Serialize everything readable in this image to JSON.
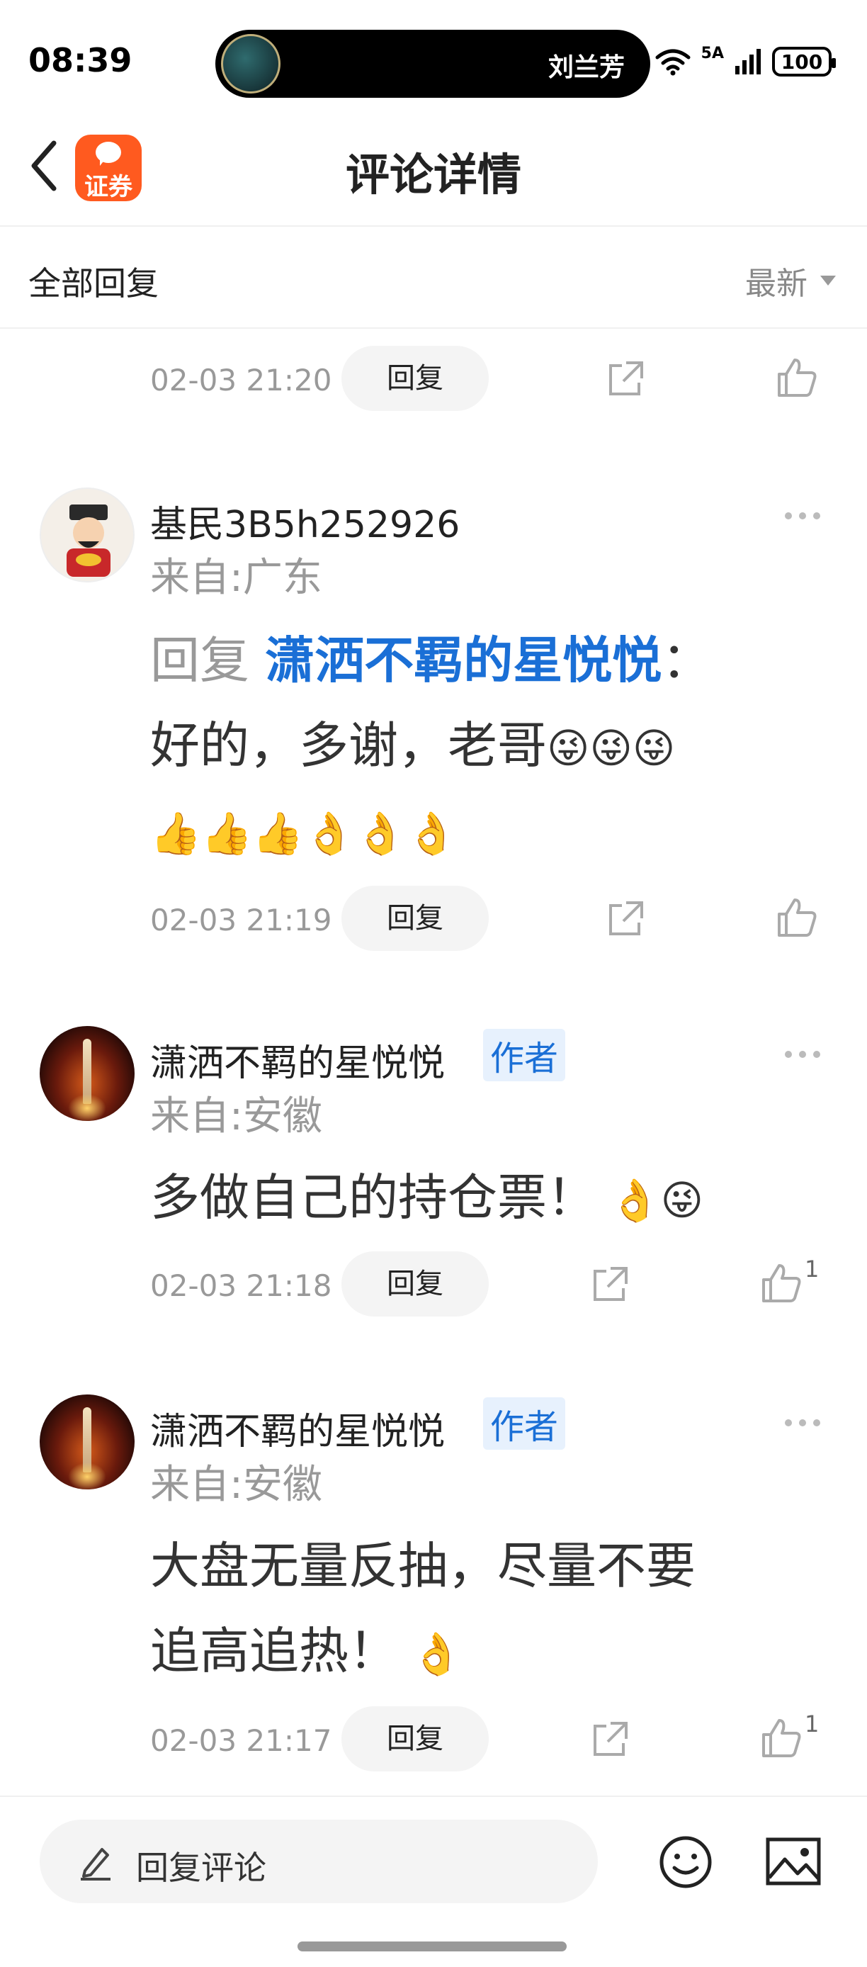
{
  "status_bar": {
    "time": "08:39",
    "island_name": "刘兰芳",
    "network": "5A",
    "battery": "100"
  },
  "nav": {
    "title": "评论详情",
    "app_logo_text": "证券"
  },
  "filter": {
    "label": "全部回复",
    "sort": "最新"
  },
  "colors": {
    "link_blue": "#1a6fd6",
    "brand_orange": "#ff5a1f",
    "muted_gray": "#999999"
  },
  "comments": [
    {
      "time": "02-03 21:20",
      "reply_label": "回复"
    },
    {
      "username": "基民3B5h252926",
      "location": "来自:广东",
      "reply_prefix": "回复",
      "mention": "潇洒不羁的星悦悦",
      "colon": "：",
      "text_line1": "好的，多谢，老哥",
      "emojis_line1": "😜😜😜",
      "emojis_line2": "👍👍👍👌👌👌",
      "time": "02-03 21:19",
      "reply_label": "回复"
    },
    {
      "username": "潇洒不羁的星悦悦",
      "badge": "作者",
      "location": "来自:安徽",
      "text": "多做自己的持仓票！",
      "emojis": " 👌😜",
      "time": "02-03 21:18",
      "reply_label": "回复",
      "likes": "1"
    },
    {
      "username": "潇洒不羁的星悦悦",
      "badge": "作者",
      "location": "来自:安徽",
      "text_line1": "大盘无量反抽，尽量不要",
      "text_line2": "追高追热！",
      "emojis": " 👌",
      "time": "02-03 21:17",
      "reply_label": "回复",
      "likes": "1"
    }
  ],
  "bottom_bar": {
    "placeholder": "回复评论"
  }
}
